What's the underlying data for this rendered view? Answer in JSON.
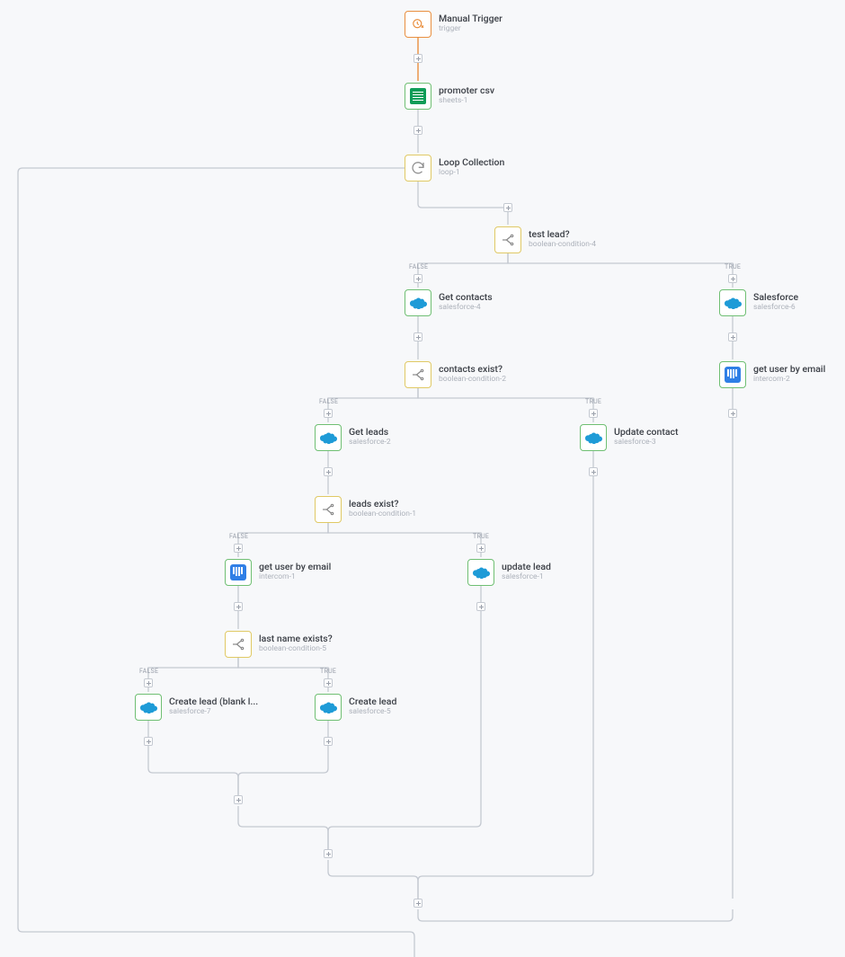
{
  "branch_labels": {
    "true": "TRUE",
    "false": "FALSE"
  },
  "nodes": {
    "trigger": {
      "title": "Manual Trigger",
      "sub": "trigger"
    },
    "sheets": {
      "title": "promoter csv",
      "sub": "sheets-1"
    },
    "loop": {
      "title": "Loop Collection",
      "sub": "loop-1"
    },
    "testlead": {
      "title": "test lead?",
      "sub": "boolean-condition-4"
    },
    "getcontacts": {
      "title": "Get contacts",
      "sub": "salesforce-4"
    },
    "sf6": {
      "title": "Salesforce",
      "sub": "salesforce-6"
    },
    "contactsExist": {
      "title": "contacts exist?",
      "sub": "boolean-condition-2"
    },
    "getleads": {
      "title": "Get leads",
      "sub": "salesforce-2"
    },
    "updatecontact": {
      "title": "Update contact",
      "sub": "salesforce-3"
    },
    "leadsExist": {
      "title": "leads exist?",
      "sub": "boolean-condition-1"
    },
    "getuser1": {
      "title": "get user by email",
      "sub": "intercom-1"
    },
    "updatelead": {
      "title": "update lead",
      "sub": "salesforce-1"
    },
    "lastname": {
      "title": "last name exists?",
      "sub": "boolean-condition-5"
    },
    "createblank": {
      "title": "Create lead (blank l...",
      "sub": "salesforce-7"
    },
    "createlead": {
      "title": "Create lead",
      "sub": "salesforce-5"
    },
    "getuser2": {
      "title": "get user by email",
      "sub": "intercom-2"
    }
  }
}
